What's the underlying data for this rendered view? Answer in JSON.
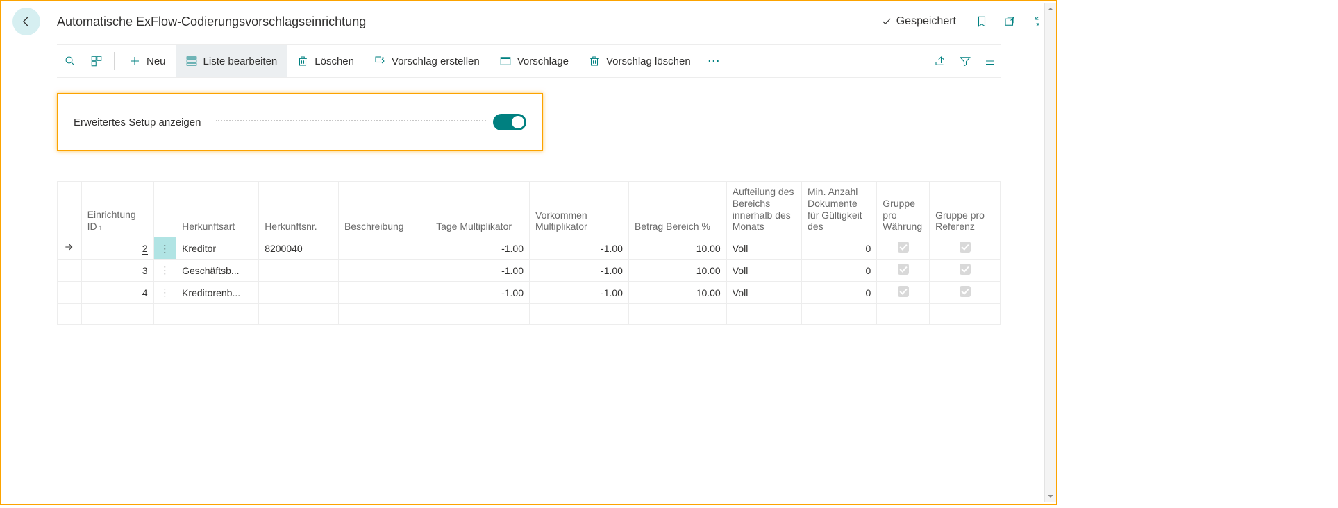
{
  "header": {
    "title": "Automatische ExFlow-Codierungsvorschlagseinrichtung",
    "saved_label": "Gespeichert"
  },
  "toolbar": {
    "new_label": "Neu",
    "edit_list_label": "Liste bearbeiten",
    "delete_label": "Löschen",
    "create_proposal_label": "Vorschlag erstellen",
    "proposals_label": "Vorschläge",
    "delete_proposal_label": "Vorschlag löschen"
  },
  "toggle": {
    "label": "Erweitertes Setup anzeigen",
    "on": true
  },
  "grid": {
    "columns": {
      "id": "Einrichtung ID",
      "source_type": "Herkunftsart",
      "source_no": "Herkunftsnr.",
      "description": "Beschreibung",
      "days_multiplier": "Tage Multiplikator",
      "occurrence_multiplier": "Vorkommen Multiplikator",
      "amount_range_pct": "Betrag Bereich %",
      "division_month": "Aufteilung des Bereichs innerhalb des Monats",
      "min_docs": "Min. Anzahl Dokumente für Gültigkeit des",
      "group_per_currency": "Gruppe pro Währung",
      "group_per_reference": "Gruppe pro Referenz"
    },
    "rows": [
      {
        "selected": true,
        "id": "2",
        "source_type": "Kreditor",
        "source_no": "8200040",
        "description": "",
        "days_multiplier": "-1.00",
        "occurrence_multiplier": "-1.00",
        "amount_range_pct": "10.00",
        "division_month": "Voll",
        "min_docs": "0",
        "group_per_currency": true,
        "group_per_reference": true
      },
      {
        "selected": false,
        "id": "3",
        "source_type": "Geschäftsb...",
        "source_no": "",
        "description": "",
        "days_multiplier": "-1.00",
        "occurrence_multiplier": "-1.00",
        "amount_range_pct": "10.00",
        "division_month": "Voll",
        "min_docs": "0",
        "group_per_currency": true,
        "group_per_reference": true
      },
      {
        "selected": false,
        "id": "4",
        "source_type": "Kreditorenb...",
        "source_no": "",
        "description": "",
        "days_multiplier": "-1.00",
        "occurrence_multiplier": "-1.00",
        "amount_range_pct": "10.00",
        "division_month": "Voll",
        "min_docs": "0",
        "group_per_currency": true,
        "group_per_reference": true
      }
    ]
  }
}
